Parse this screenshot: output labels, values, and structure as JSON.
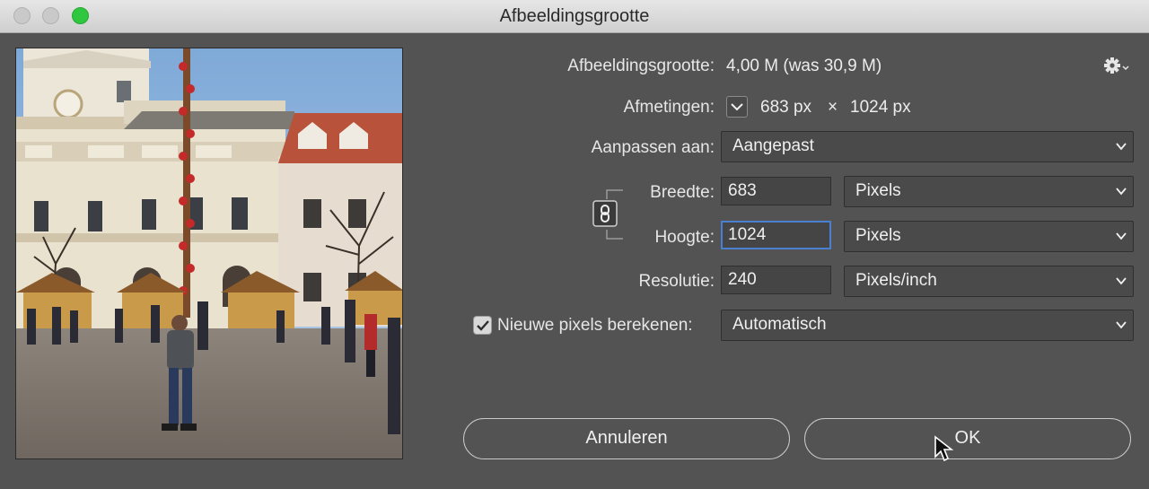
{
  "window": {
    "title": "Afbeeldingsgrootte"
  },
  "image_size": {
    "label": "Afbeeldingsgrootte:",
    "value": "4,00 M (was 30,9 M)"
  },
  "dimensions": {
    "label": "Afmetingen:",
    "width": "683 px",
    "times": "×",
    "height": "1024 px"
  },
  "fit_to": {
    "label": "Aanpassen aan:",
    "value": "Aangepast"
  },
  "width": {
    "label": "Breedte:",
    "value": "683",
    "unit": "Pixels"
  },
  "height": {
    "label": "Hoogte:",
    "value": "1024",
    "unit": "Pixels"
  },
  "resolution": {
    "label": "Resolutie:",
    "value": "240",
    "unit": "Pixels/inch"
  },
  "resample": {
    "label": "Nieuwe pixels berekenen:",
    "checked": true,
    "method": "Automatisch"
  },
  "buttons": {
    "cancel": "Annuleren",
    "ok": "OK"
  },
  "icons": {
    "settings": "gear-icon",
    "dimensions_toggle": "chevron-down-icon",
    "constrain": "chain-link-icon",
    "cursor": "mouse-pointer-icon"
  },
  "colors": {
    "focus": "#4a7fd0",
    "zoom_button": "#2fc73f"
  }
}
